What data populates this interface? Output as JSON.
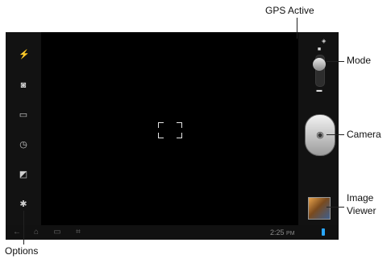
{
  "callouts": {
    "gps": "GPS Active",
    "mode": "Mode",
    "camera": "Camera",
    "image_viewer_1": "Image",
    "image_viewer_2": "Viewer",
    "options": "Options"
  },
  "status_bar": {
    "time": "2:25",
    "ampm": "PM"
  },
  "icons": {
    "flash": "flash-icon",
    "self_portrait": "switch-camera-icon",
    "shooting_mode": "shooting-mode-icon",
    "timer": "timer-icon",
    "exposure": "exposure-icon",
    "settings": "gear-icon",
    "back": "back-icon",
    "home": "home-icon",
    "recent": "recent-apps-icon",
    "screenshot": "screenshot-icon",
    "gps": "gps-icon",
    "shutter": "camera-shutter-icon"
  },
  "colors": {
    "accent": "#2aa7ff",
    "viewfinder": "#000000"
  }
}
